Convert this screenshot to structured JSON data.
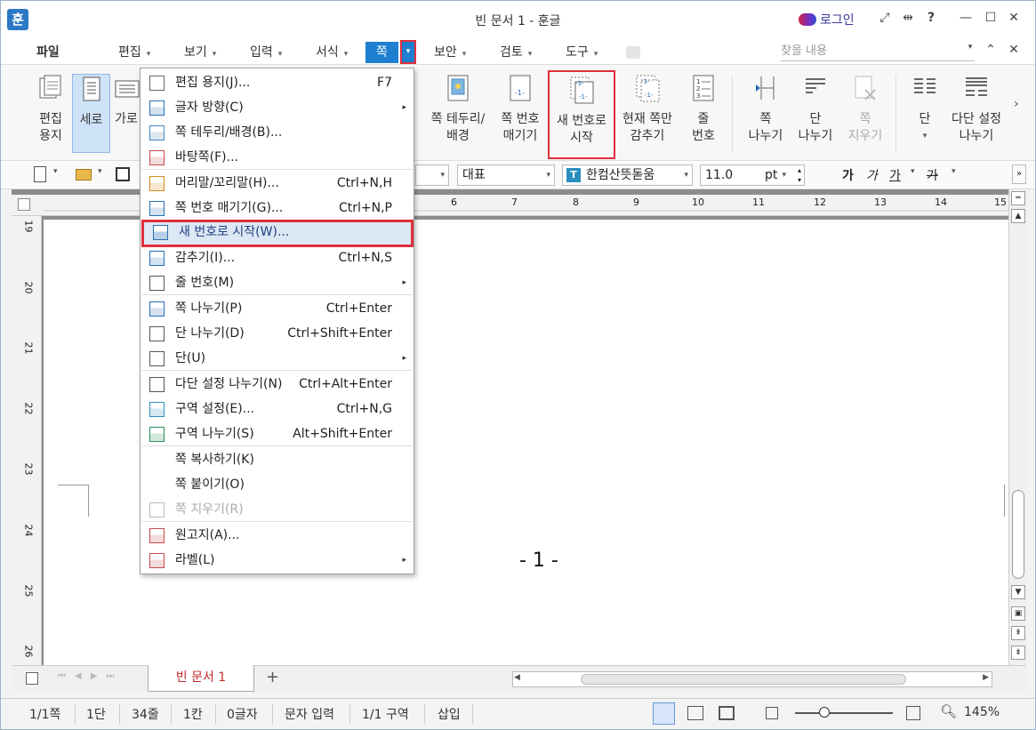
{
  "window": {
    "title": "빈 문서 1 - 훈글",
    "app_icon": "훈",
    "login": "로그인"
  },
  "menu": {
    "file": "파일",
    "tabs": [
      "편집",
      "보기",
      "입력",
      "서식",
      "쪽",
      "보안",
      "검토",
      "도구"
    ],
    "search_placeholder": "찾을 내용"
  },
  "ribbon": {
    "edit_paper": "편집\n용지",
    "portrait": "세로",
    "landscape": "가로",
    "page_border": "쪽 테두리/\n배경",
    "page_number": "쪽 번호\n매기기",
    "new_number": "새 번호로\n시작",
    "hide_current": "현재 쪽만\n감추기",
    "line_number": "줄\n번호",
    "page_break": "쪽\n나누기",
    "column_break": "단\n나누기",
    "page_delete": "쪽\n지우기",
    "columns": "단",
    "multi_column": "다단 설정\n나누기"
  },
  "toolbar": {
    "style": "대표",
    "font": "한컴산뜻돋움",
    "size": "11.0",
    "unit": "pt",
    "formats": [
      "가",
      "가",
      "가",
      "가"
    ]
  },
  "ruler": {
    "h_ticks": [
      "6",
      "7",
      "8",
      "9",
      "10",
      "11",
      "12",
      "13",
      "14",
      "15"
    ],
    "v_ticks": [
      "19",
      "20",
      "21",
      "22",
      "23",
      "24",
      "25",
      "26"
    ]
  },
  "dropdown": {
    "items": [
      {
        "label": "편집 용지(J)...",
        "shortcut": "F7",
        "icon": "paper-icon"
      },
      {
        "label": "글자 방향(C)",
        "shortcut": "",
        "icon": "text-direction-icon",
        "submenu": true
      },
      {
        "label": "쪽 테두리/배경(B)...",
        "shortcut": "",
        "icon": "page-border-icon"
      },
      {
        "label": "바탕쪽(F)...",
        "shortcut": "",
        "icon": "master-page-icon"
      },
      {
        "label": "머리말/꼬리말(H)...",
        "shortcut": "Ctrl+N,H",
        "icon": "header-footer-icon"
      },
      {
        "label": "쪽 번호 매기기(G)...",
        "shortcut": "Ctrl+N,P",
        "icon": "page-number-icon"
      },
      {
        "label": "새 번호로 시작(W)...",
        "shortcut": "",
        "icon": "new-number-icon"
      },
      {
        "label": "감추기(I)...",
        "shortcut": "Ctrl+N,S",
        "icon": "hide-icon"
      },
      {
        "label": "줄 번호(M)",
        "shortcut": "",
        "icon": "line-number-icon",
        "submenu": true
      },
      {
        "label": "쪽 나누기(P)",
        "shortcut": "Ctrl+Enter",
        "icon": "page-break-icon"
      },
      {
        "label": "단 나누기(D)",
        "shortcut": "Ctrl+Shift+Enter",
        "icon": "column-break-icon"
      },
      {
        "label": "단(U)",
        "shortcut": "",
        "icon": "columns-icon",
        "submenu": true
      },
      {
        "label": "다단 설정 나누기(N)",
        "shortcut": "Ctrl+Alt+Enter",
        "icon": "multi-column-icon"
      },
      {
        "label": "구역 설정(E)...",
        "shortcut": "Ctrl+N,G",
        "icon": "section-settings-icon"
      },
      {
        "label": "구역 나누기(S)",
        "shortcut": "Alt+Shift+Enter",
        "icon": "section-break-icon"
      },
      {
        "label": "쪽 복사하기(K)",
        "shortcut": "",
        "icon": ""
      },
      {
        "label": "쪽 붙이기(O)",
        "shortcut": "",
        "icon": ""
      },
      {
        "label": "쪽 지우기(R)",
        "shortcut": "",
        "icon": "page-delete-icon",
        "disabled": true
      },
      {
        "label": "원고지(A)...",
        "shortcut": "",
        "icon": "manuscript-icon"
      },
      {
        "label": "라벨(L)",
        "shortcut": "",
        "icon": "label-icon",
        "submenu": true
      }
    ]
  },
  "document": {
    "page_number_text": "- 1 -",
    "tab_name": "빈 문서 1"
  },
  "status": {
    "page": "1/1쪽",
    "column": "1단",
    "line": "34줄",
    "col": "1칸",
    "chars": "0글자",
    "mode": "문자 입력",
    "section": "1/1 구역",
    "insert": "삽입",
    "zoom": "145%",
    "zoom_level": 0.3
  },
  "colors": {
    "accent": "#1e7fd0",
    "highlight": "#e0303a",
    "doc_tab_text": "#c02a2a"
  }
}
